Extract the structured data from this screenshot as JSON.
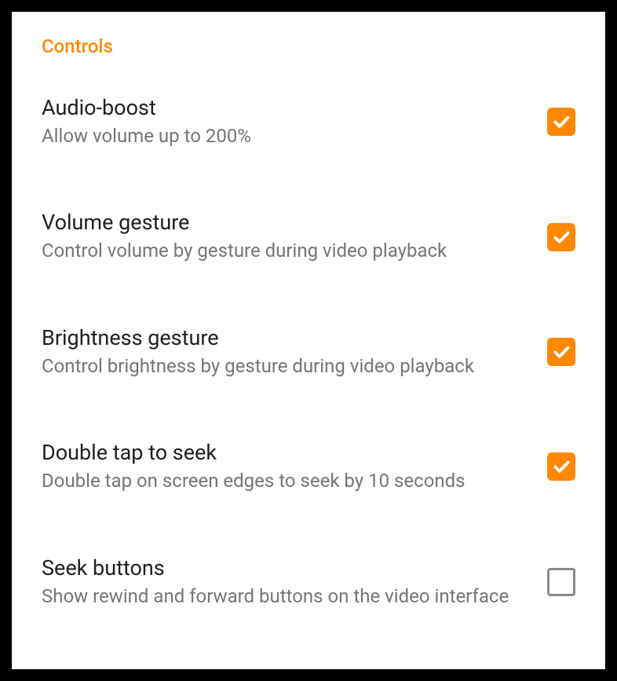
{
  "colors": {
    "accent": "#ff8800",
    "text_primary": "#202020",
    "text_secondary": "#757575"
  },
  "section": {
    "header": "Controls"
  },
  "settings": [
    {
      "title": "Audio-boost",
      "description": "Allow volume up to 200%",
      "checked": true
    },
    {
      "title": "Volume gesture",
      "description": "Control volume by gesture during video playback",
      "checked": true
    },
    {
      "title": "Brightness gesture",
      "description": "Control brightness by gesture during video playback",
      "checked": true
    },
    {
      "title": "Double tap to seek",
      "description": "Double tap on screen edges to seek by 10 seconds",
      "checked": true
    },
    {
      "title": "Seek buttons",
      "description": "Show rewind and forward buttons on the video interface",
      "checked": false
    }
  ]
}
